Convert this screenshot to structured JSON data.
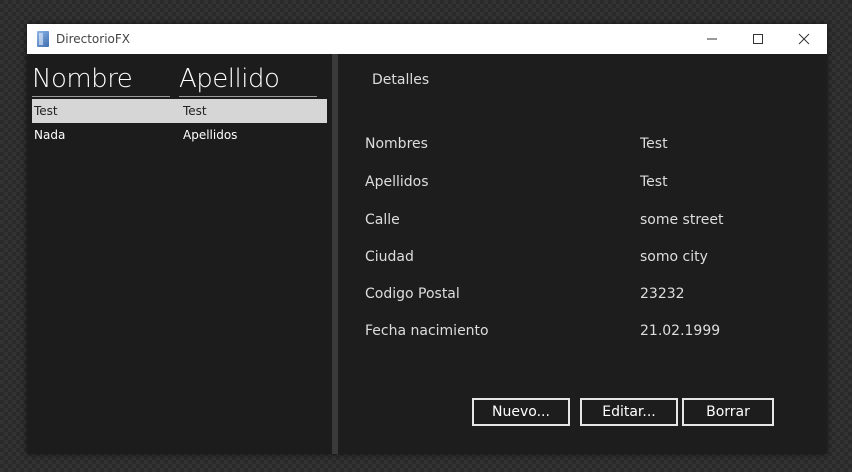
{
  "window": {
    "title": "DirectorioFX"
  },
  "table": {
    "columns": [
      "Nombre",
      "Apellido"
    ],
    "rows": [
      {
        "nombre": "Test",
        "apellido": "Test",
        "selected": true
      },
      {
        "nombre": "Nada",
        "apellido": "Apellidos",
        "selected": false
      }
    ]
  },
  "details": {
    "title": "Detalles",
    "fields": [
      {
        "label": "Nombres",
        "value": "Test"
      },
      {
        "label": "Apellidos",
        "value": "Test"
      },
      {
        "label": "Calle",
        "value": "some street"
      },
      {
        "label": "Ciudad",
        "value": "somo city"
      },
      {
        "label": "Codigo Postal",
        "value": "23232"
      },
      {
        "label": "Fecha nacimiento",
        "value": "21.02.1999"
      }
    ]
  },
  "buttons": {
    "new": "Nuevo...",
    "edit": "Editar...",
    "delete": "Borrar"
  },
  "colors": {
    "background": "#1c1c1c",
    "selection": "#d6d6d6",
    "text": "#ffffff"
  }
}
